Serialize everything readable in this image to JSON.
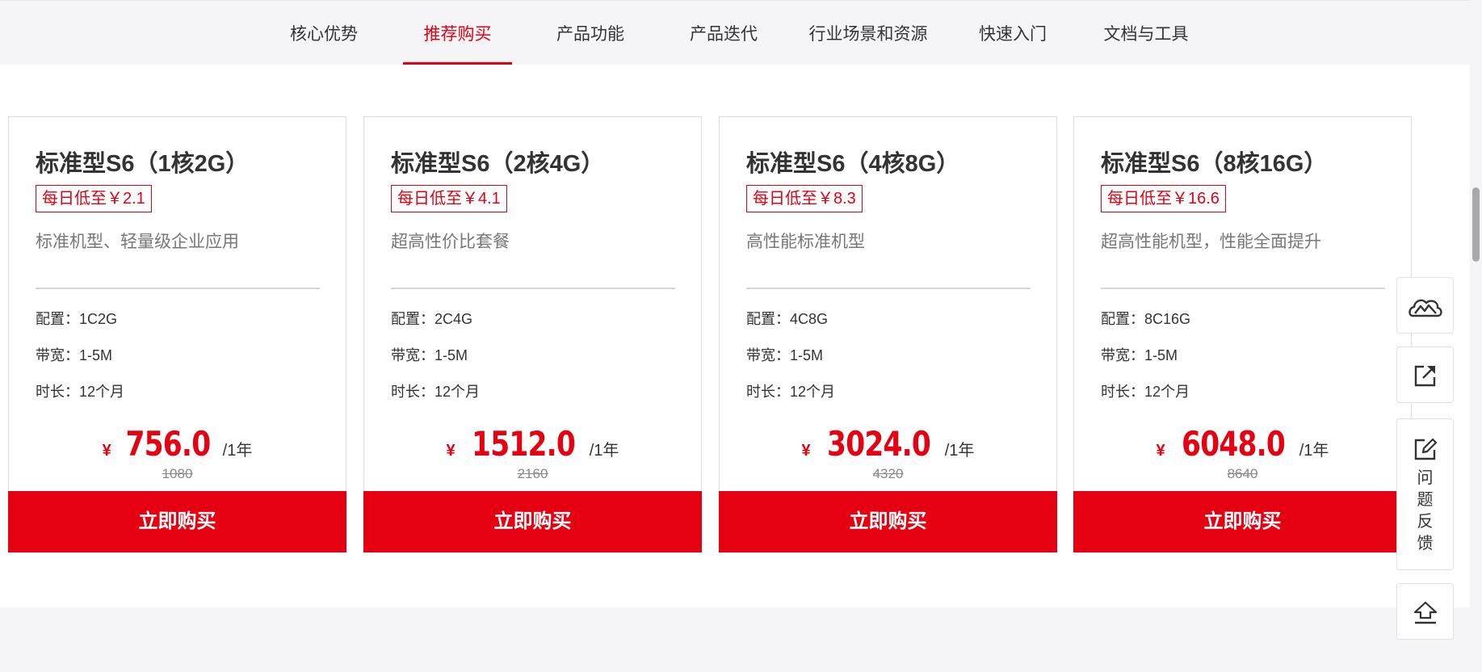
{
  "nav": {
    "items": [
      "核心优势",
      "推荐购买",
      "产品功能",
      "产品迭代",
      "行业场景和资源",
      "快速入门",
      "文档与工具"
    ],
    "active_index": 1
  },
  "cards": [
    {
      "title": "标准型S6（1核2G）",
      "badge": "每日低至￥2.1",
      "desc": "标准机型、轻量级企业应用",
      "spec_config": "配置：1C2G",
      "spec_bandwidth": "带宽：1-5M",
      "spec_duration": "时长：12个月",
      "currency": "¥",
      "price": "756.0",
      "unit": "/1年",
      "original_price": "1080",
      "buy_label": "立即购买"
    },
    {
      "title": "标准型S6（2核4G）",
      "badge": "每日低至￥4.1",
      "desc": "超高性价比套餐",
      "spec_config": "配置：2C4G",
      "spec_bandwidth": "带宽：1-5M",
      "spec_duration": "时长：12个月",
      "currency": "¥",
      "price": "1512.0",
      "unit": "/1年",
      "original_price": "2160",
      "buy_label": "立即购买"
    },
    {
      "title": "标准型S6（4核8G）",
      "badge": "每日低至￥8.3",
      "desc": "高性能标准机型",
      "spec_config": "配置：4C8G",
      "spec_bandwidth": "带宽：1-5M",
      "spec_duration": "时长：12个月",
      "currency": "¥",
      "price": "3024.0",
      "unit": "/1年",
      "original_price": "4320",
      "buy_label": "立即购买"
    },
    {
      "title": "标准型S6（8核16G）",
      "badge": "每日低至￥16.6",
      "desc": "超高性能机型，性能全面提升",
      "spec_config": "配置：8C16G",
      "spec_bandwidth": "带宽：1-5M",
      "spec_duration": "时长：12个月",
      "currency": "¥",
      "price": "6048.0",
      "unit": "/1年",
      "original_price": "8640",
      "buy_label": "立即购买"
    }
  ],
  "tools": {
    "feedback_label": "问题反馈",
    "icons": [
      "cloud-mountain-icon",
      "share-icon",
      "edit-icon",
      "back-to-top-icon"
    ]
  },
  "colors": {
    "accent": "#e50012",
    "text": "#333333",
    "muted": "#777777"
  }
}
